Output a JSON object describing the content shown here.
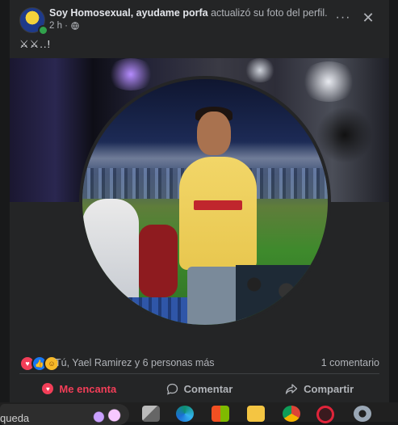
{
  "post": {
    "author": "Soy Homosexual, ayudame porfa",
    "action": "actualizó su foto del perfil.",
    "time": "2 h ·",
    "caption": "⚔⚔..!",
    "more_label": "···",
    "close_label": "✕"
  },
  "reactions": {
    "summary": "Tú, Yael Ramirez y 6 personas más",
    "comments": "1 comentario",
    "icons": [
      "love",
      "like",
      "care"
    ]
  },
  "actions": {
    "love_label": "Me encanta",
    "comment_label": "Comentar",
    "share_label": "Compartir"
  },
  "taskbar": {
    "search_text": "queda",
    "apps": [
      "task-view-icon",
      "edge-icon",
      "store-icon",
      "file-explorer-icon",
      "chrome-icon",
      "opera-icon",
      "settings-icon"
    ]
  },
  "colors": {
    "background": "#18191a",
    "card": "#242526",
    "text_primary": "#e4e6eb",
    "text_secondary": "#b0b3b8",
    "love": "#f33e58",
    "like": "#1877f2"
  }
}
